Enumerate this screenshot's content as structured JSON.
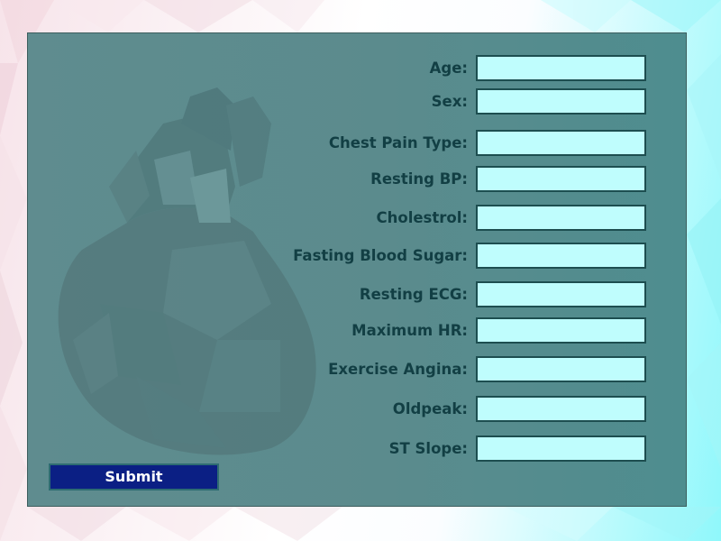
{
  "form": {
    "fields": [
      {
        "label": "Age:",
        "value": ""
      },
      {
        "label": "Sex:",
        "value": ""
      },
      {
        "label": "Chest Pain Type:",
        "value": ""
      },
      {
        "label": "Resting BP:",
        "value": ""
      },
      {
        "label": "Cholestrol:",
        "value": ""
      },
      {
        "label": "Fasting Blood Sugar:",
        "value": ""
      },
      {
        "label": "Resting ECG:",
        "value": ""
      },
      {
        "label": "Maximum HR:",
        "value": ""
      },
      {
        "label": "Exercise Angina:",
        "value": ""
      },
      {
        "label": "Oldpeak:",
        "value": ""
      },
      {
        "label": "ST Slope:",
        "value": ""
      }
    ],
    "submit_label": "Submit"
  },
  "colors": {
    "panel": "#5b8b8d",
    "input_bg": "#bffdfd",
    "label_text": "#123f44",
    "submit_bg": "#0b1f84",
    "submit_text": "#ffffff"
  },
  "icons": {
    "background_art": "polygonal-heart-illustration"
  }
}
